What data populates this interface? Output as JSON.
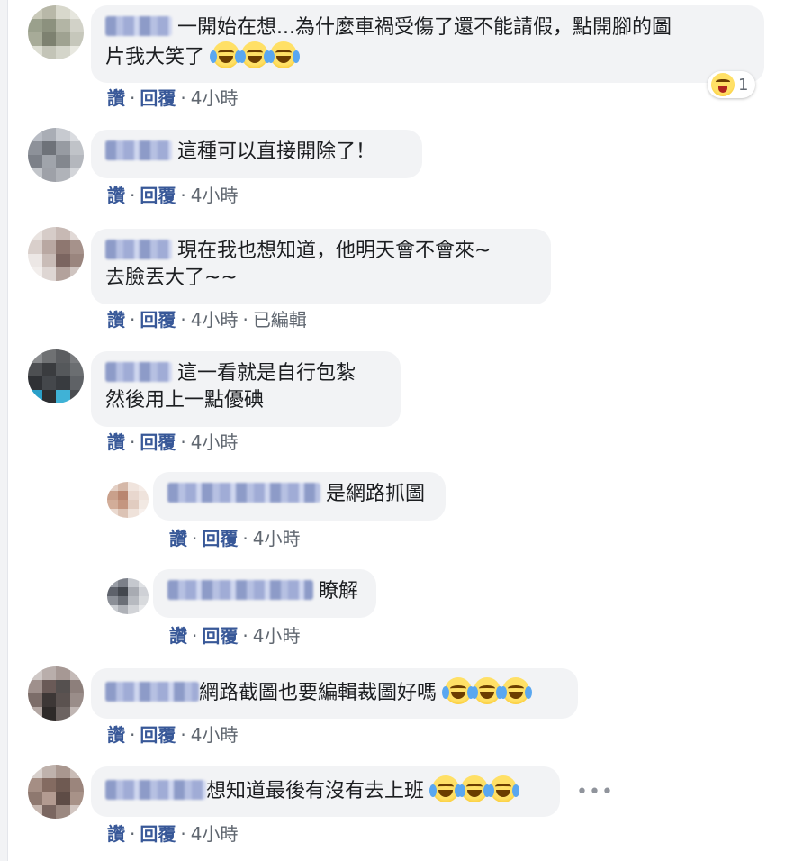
{
  "actions": {
    "like": "讚",
    "reply": "回覆",
    "sep": "·",
    "edited": "已編輯"
  },
  "comments": [
    {
      "text_line1": "一開始在想...為什麼車禍受傷了還不能請假，點開腳的圖",
      "text_line2": "片我大笑了",
      "time": "4小時",
      "reaction_count": "1"
    },
    {
      "text_line1": "這種可以直接開除了！",
      "time": "4小時"
    },
    {
      "text_line1": "現在我也想知道，他明天會不會來~",
      "text_line2": "去臉丟大了~~",
      "time": "4小時"
    },
    {
      "text_line1": "這一看就是自行包紮",
      "text_line2": "然後用上一點優碘",
      "time": "4小時"
    },
    {
      "text_line1": "是網路抓圖",
      "time": "4小時"
    },
    {
      "text_line1": "瞭解",
      "time": "4小時"
    },
    {
      "text_line1": "網路截圖也要編輯裁圖好嗎",
      "time": "4小時"
    },
    {
      "text_line1": "想知道最後有沒有去上班",
      "time": "4小時",
      "more": "•••"
    }
  ],
  "colors": {
    "link": "#385898",
    "meta": "#606770",
    "bubble": "#f2f3f5"
  },
  "icons": [
    "laugh-tears-emoji",
    "haha-reaction-icon",
    "more-options-icon"
  ]
}
